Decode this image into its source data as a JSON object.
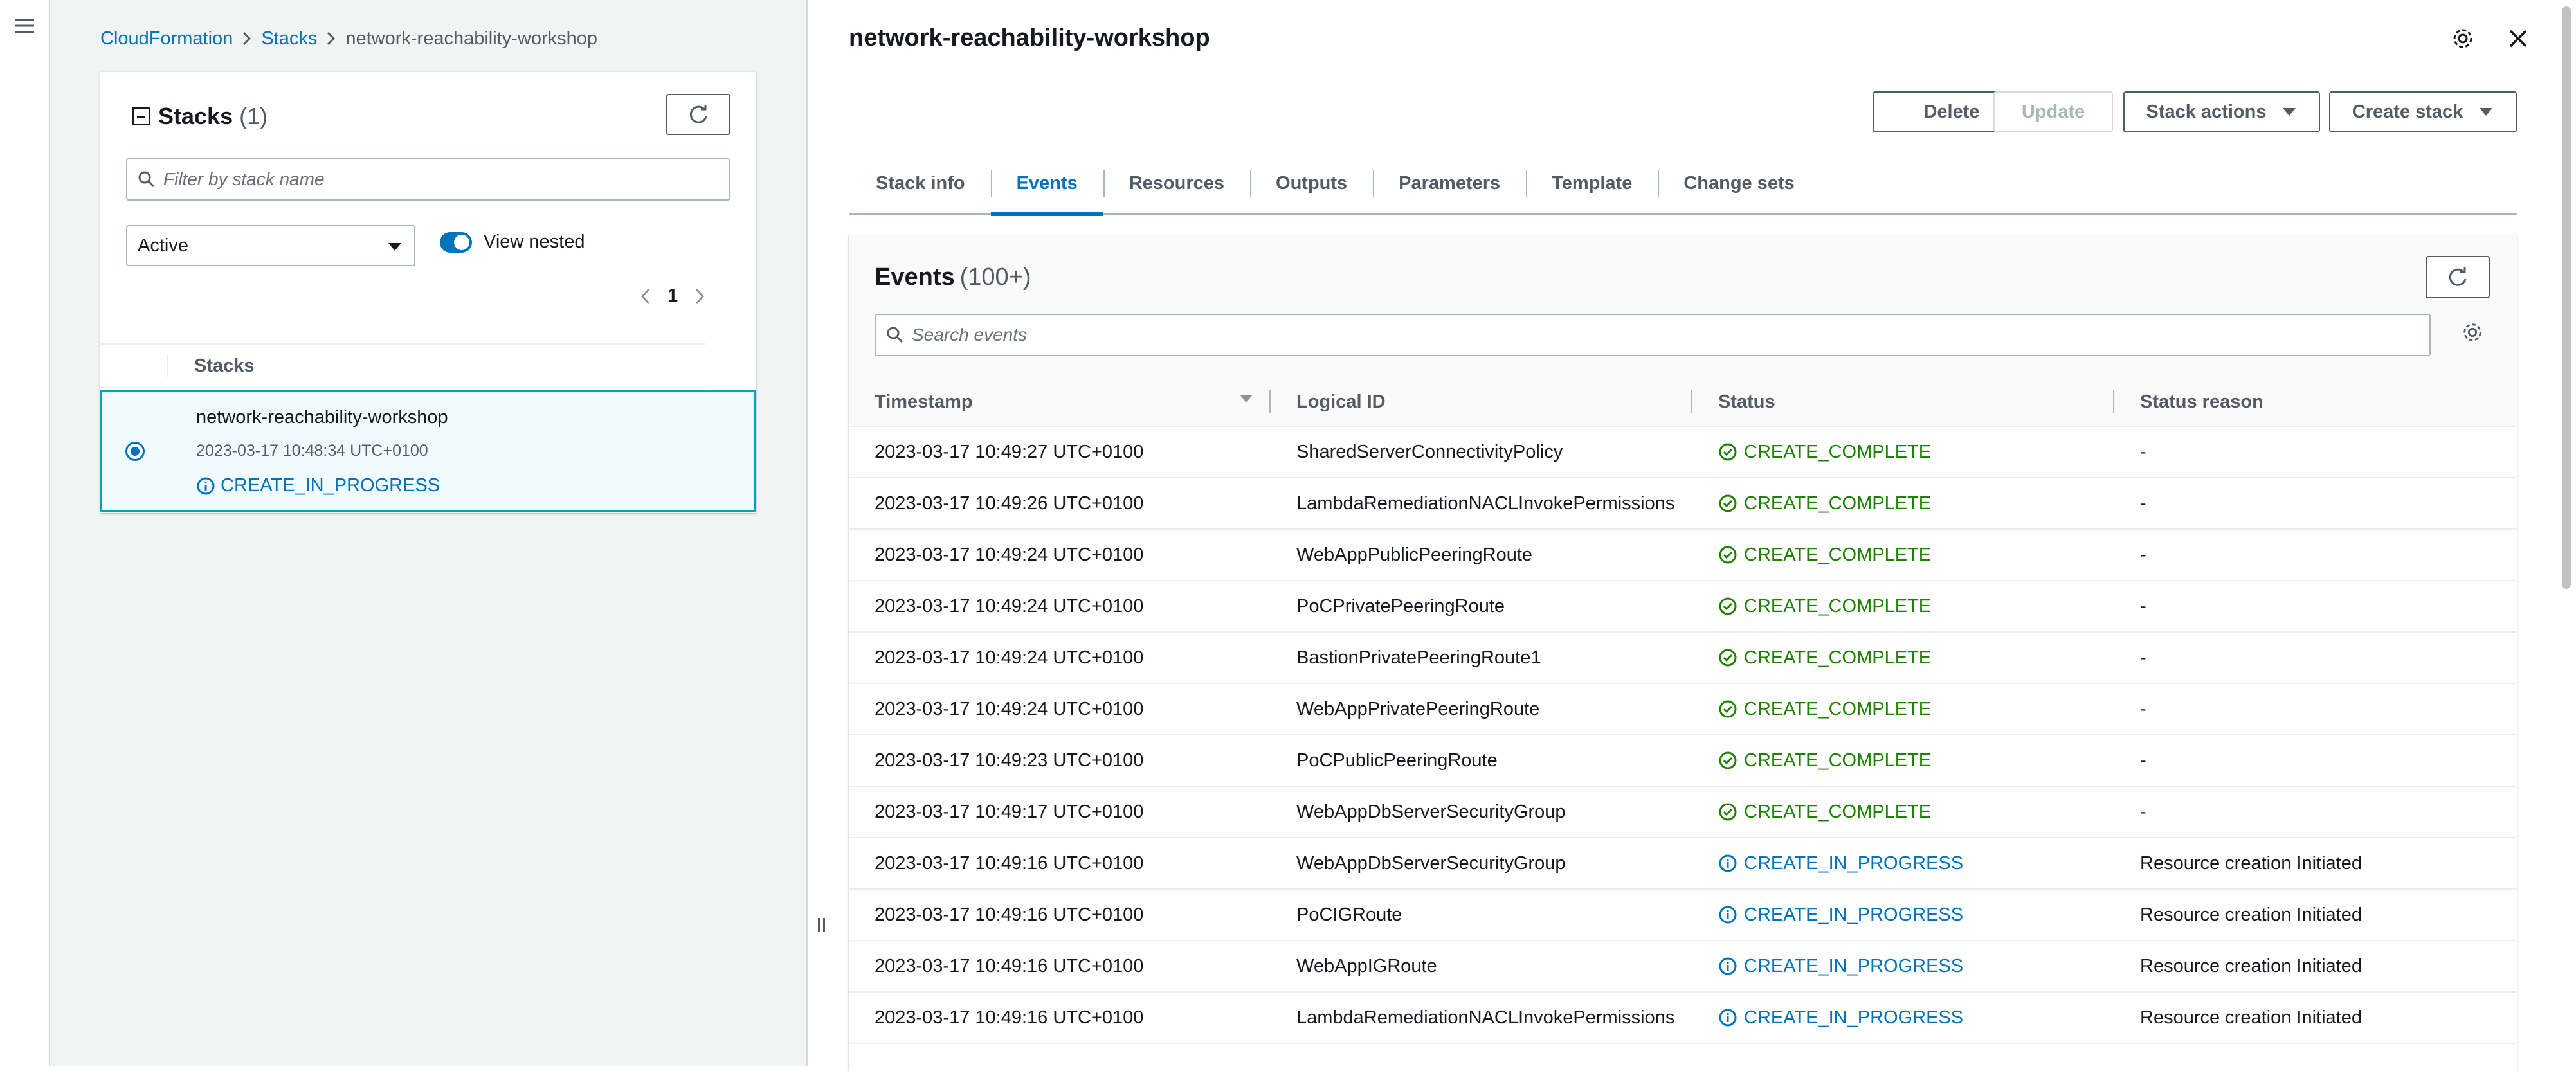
{
  "breadcrumb": {
    "root": "CloudFormation",
    "stacks": "Stacks",
    "current": "network-reachability-workshop"
  },
  "stacks_panel": {
    "title": "Stacks",
    "count": "(1)",
    "filter_placeholder": "Filter by stack name",
    "status_filter": "Active",
    "view_nested_label": "View nested",
    "page": "1",
    "column_header": "Stacks",
    "stack": {
      "name": "network-reachability-workshop",
      "created": "2023-03-17 10:48:34 UTC+0100",
      "status": "CREATE_IN_PROGRESS"
    }
  },
  "detail": {
    "title": "network-reachability-workshop",
    "buttons": {
      "delete": "Delete",
      "update": "Update",
      "stack_actions": "Stack actions",
      "create_stack": "Create stack"
    },
    "tabs": [
      "Stack info",
      "Events",
      "Resources",
      "Outputs",
      "Parameters",
      "Template",
      "Change sets"
    ],
    "active_tab": "Events"
  },
  "events": {
    "title": "Events",
    "count": "(100+)",
    "search_placeholder": "Search events",
    "columns": {
      "timestamp": "Timestamp",
      "logical_id": "Logical ID",
      "status": "Status",
      "reason": "Status reason"
    },
    "rows": [
      {
        "ts": "2023-03-17 10:49:27 UTC+0100",
        "id": "SharedServerConnectivityPolicy",
        "status": "CREATE_COMPLETE",
        "reason": "-"
      },
      {
        "ts": "2023-03-17 10:49:26 UTC+0100",
        "id": "LambdaRemediationNACLInvokePermissions",
        "status": "CREATE_COMPLETE",
        "reason": "-"
      },
      {
        "ts": "2023-03-17 10:49:24 UTC+0100",
        "id": "WebAppPublicPeeringRoute",
        "status": "CREATE_COMPLETE",
        "reason": "-"
      },
      {
        "ts": "2023-03-17 10:49:24 UTC+0100",
        "id": "PoCPrivatePeeringRoute",
        "status": "CREATE_COMPLETE",
        "reason": "-"
      },
      {
        "ts": "2023-03-17 10:49:24 UTC+0100",
        "id": "BastionPrivatePeeringRoute1",
        "status": "CREATE_COMPLETE",
        "reason": "-"
      },
      {
        "ts": "2023-03-17 10:49:24 UTC+0100",
        "id": "WebAppPrivatePeeringRoute",
        "status": "CREATE_COMPLETE",
        "reason": "-"
      },
      {
        "ts": "2023-03-17 10:49:23 UTC+0100",
        "id": "PoCPublicPeeringRoute",
        "status": "CREATE_COMPLETE",
        "reason": "-"
      },
      {
        "ts": "2023-03-17 10:49:17 UTC+0100",
        "id": "WebAppDbServerSecurityGroup",
        "status": "CREATE_COMPLETE",
        "reason": "-"
      },
      {
        "ts": "2023-03-17 10:49:16 UTC+0100",
        "id": "WebAppDbServerSecurityGroup",
        "status": "CREATE_IN_PROGRESS",
        "reason": "Resource creation Initiated"
      },
      {
        "ts": "2023-03-17 10:49:16 UTC+0100",
        "id": "PoCIGRoute",
        "status": "CREATE_IN_PROGRESS",
        "reason": "Resource creation Initiated"
      },
      {
        "ts": "2023-03-17 10:49:16 UTC+0100",
        "id": "WebAppIGRoute",
        "status": "CREATE_IN_PROGRESS",
        "reason": "Resource creation Initiated"
      },
      {
        "ts": "2023-03-17 10:49:16 UTC+0100",
        "id": "LambdaRemediationNACLInvokePermissions",
        "status": "CREATE_IN_PROGRESS",
        "reason": "Resource creation Initiated"
      }
    ]
  },
  "icons": {
    "menu": "hamburger-icon",
    "refresh": "refresh-icon",
    "search": "search-icon",
    "settings": "gear-icon",
    "close": "close-icon",
    "success": "check-circle-icon",
    "info": "info-circle-icon"
  },
  "colors": {
    "link": "#0073bb",
    "success": "#1d8102",
    "info": "#0073bb"
  }
}
